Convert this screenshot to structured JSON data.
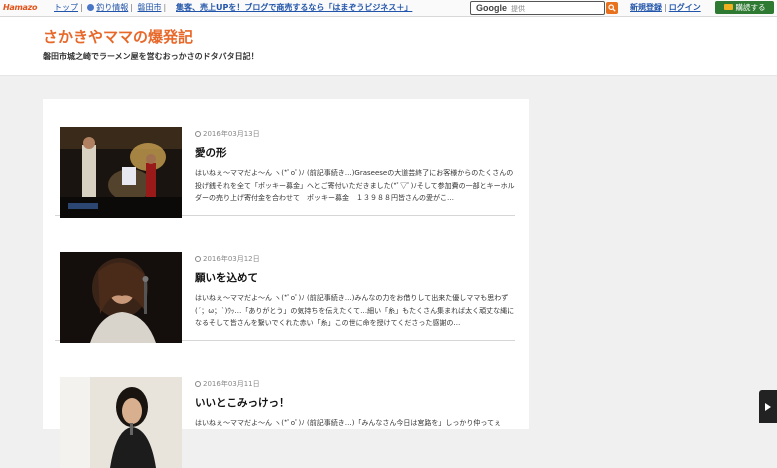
{
  "topbar": {
    "logo": "Hamazo",
    "nav": [
      "トップ",
      "釣り情報",
      "磐田市"
    ],
    "promo": "集客、売上UPを！ブログで商売するなら「はまぞうビジネス＋」",
    "search": {
      "brand": "Google",
      "placeholder": "提供"
    },
    "signup": "新規登録",
    "login": "ログイン",
    "subscribe": "購読する"
  },
  "header": {
    "title": "さかきやママの爆発記",
    "description": "磐田市城之崎でラーメン屋を営むおっかさのドタバタ日記！"
  },
  "posts": [
    {
      "date": "2016年03月13日",
      "title": "愛の形",
      "excerpt": "はいねぇ～ママだよ～ん ヽ(*ﾟoﾟ)ﾉ (前記事続き…)Graseeseの大道芸終了にお客様からのたくさんの投げ銭それを全て「ポッキー募金」へとご寄付いただきました(*ﾟ▽ﾟ)ﾉそして参加費の一部とキーホルダーの売り上げ寄付金を合わせて　ポッキー募金　１３９８８円皆さんの愛がこ…"
    },
    {
      "date": "2016年03月12日",
      "title": "願いを込めて",
      "excerpt": "はいねぇ～ママだよ～ん ヽ(*ﾟoﾟ)ﾉ (前記事続き…)みんなの力をお借りして出来た優しママも思わず(´；ω；`)ｳｯ…「ありがとう」の気持ちを伝えたくて…細い「糸」もたくさん集まれば太く頑丈な縄になるそして皆さんを繋いでくれた赤い「糸」この世に命を授けてくださった感謝の…"
    },
    {
      "date": "2016年03月11日",
      "title": "いいとこみっけっ！",
      "excerpt": "はいねぇ～ママだよ～ん ヽ(*ﾟoﾟ)ﾉ (前記事続き…)「みんなさん今日は宮路を」しっかり仲ってぇ"
    }
  ],
  "colors": {
    "accent": "#e8682a",
    "link": "#2255aa",
    "subscribe_bg": "#2f7a32",
    "search_btn": "#e8711e"
  },
  "icons": [
    "gear-icon",
    "search-icon",
    "rss-icon",
    "clock-icon",
    "arrow-right-icon"
  ]
}
